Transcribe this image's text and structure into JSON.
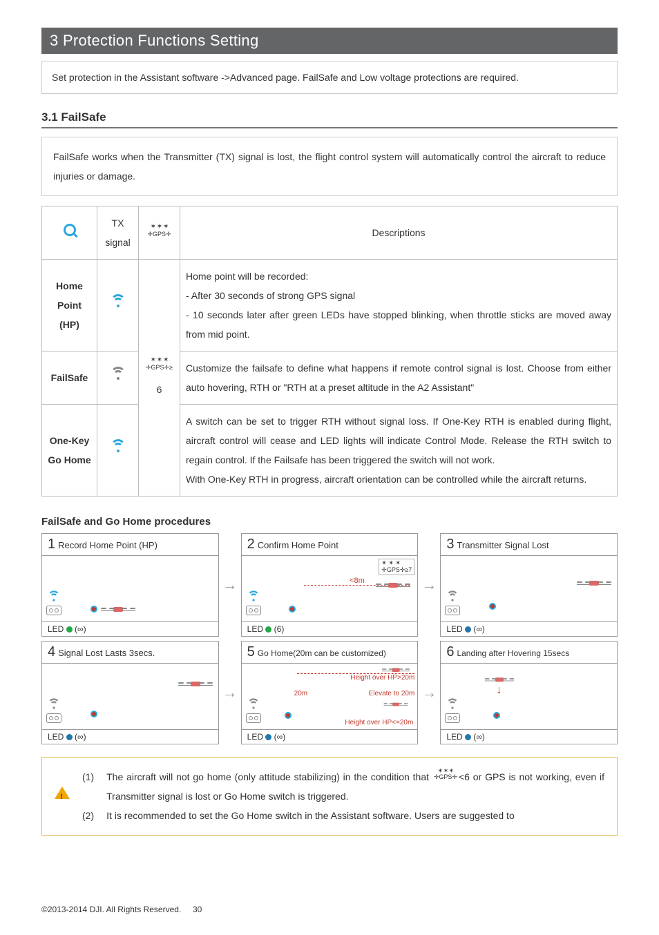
{
  "section": {
    "banner": "3 Protection Functions Setting",
    "intro": "Set protection in the Assistant software ->Advanced page. FailSafe and Low voltage protections are required."
  },
  "failsafe": {
    "heading": "3.1 FailSafe",
    "desc": "FailSafe works when the Transmitter (TX) signal is lost, the flight control system will automatically control the aircraft to reduce injuries or damage.",
    "table": {
      "headers": {
        "mag": "",
        "tx": "TX signal",
        "gps_stars": "✶ ✶ ✶",
        "gps_txt": "✛GPS✛",
        "desc": "Descriptions"
      },
      "gps_cell": {
        "stars": "✶ ✶ ✶",
        "txt": "✛GPS✛≥",
        "num": "6"
      },
      "rows": [
        {
          "label": "Home Point (HP)",
          "wifi_color": "blue",
          "desc": "Home point will be recorded:\n- After 30 seconds of strong GPS signal\n- 10 seconds later after green LEDs have stopped blinking, when throttle sticks are moved away from mid point."
        },
        {
          "label": "FailSafe",
          "wifi_color": "gray",
          "desc": "Customize the failsafe to define what happens if remote control signal is lost. Choose from either auto hovering, RTH or \"RTH at a preset altitude in the A2 Assistant\""
        },
        {
          "label": "One-Key Go Home",
          "wifi_color": "blue",
          "desc": "A switch can be set to trigger RTH without signal loss. If One-Key RTH is enabled during flight, aircraft control will cease and LED lights will indicate Control Mode. Release the RTH switch to regain control. If the Failsafe has been triggered the switch will not work.\nWith One-Key RTH in progress, aircraft orientation can be controlled while the aircraft returns."
        }
      ]
    }
  },
  "procedures": {
    "title": "FailSafe and Go Home procedures",
    "steps": [
      {
        "n": "1",
        "title": "Record Home Point (HP)",
        "led": "LED ● (∞)",
        "gps_badge": ""
      },
      {
        "n": "2",
        "title": "Confirm Home Point",
        "led": "LED ● (6)",
        "gps_badge": "✶ ✶ ✶\n✛GPS✛≥7",
        "dist": "<8m"
      },
      {
        "n": "3",
        "title": "Transmitter Signal Lost",
        "led": "LED ● (∞)"
      },
      {
        "n": "4",
        "title": "Signal Lost Lasts 3secs.",
        "led": "LED ● (∞)"
      },
      {
        "n": "5",
        "title": "Go Home(20m can be customized)",
        "led": "LED ● (∞)",
        "l1": "Height over HP>20m",
        "l2": "Elevate to 20m",
        "l2a": "20m",
        "l3": "Height over HP<=20m"
      },
      {
        "n": "6",
        "title": "Landing after Hovering 15secs",
        "led": "LED ● (∞)"
      }
    ]
  },
  "warning": {
    "items": [
      {
        "n": "(1)",
        "pre": "The aircraft will not go home (only attitude stabilizing) in the condition that",
        "gps_stars": "✶ ✶ ✶",
        "gps_txt": "✛GPS✛",
        "post": "<6 or GPS is not working, even if Transmitter signal is lost or Go Home switch is triggered."
      },
      {
        "n": "(2)",
        "text": "It is recommended to set the Go Home switch in the Assistant software. Users are suggested to"
      }
    ]
  },
  "footer": {
    "copyright": "©2013-2014 DJI. All Rights Reserved.",
    "page": "30"
  }
}
